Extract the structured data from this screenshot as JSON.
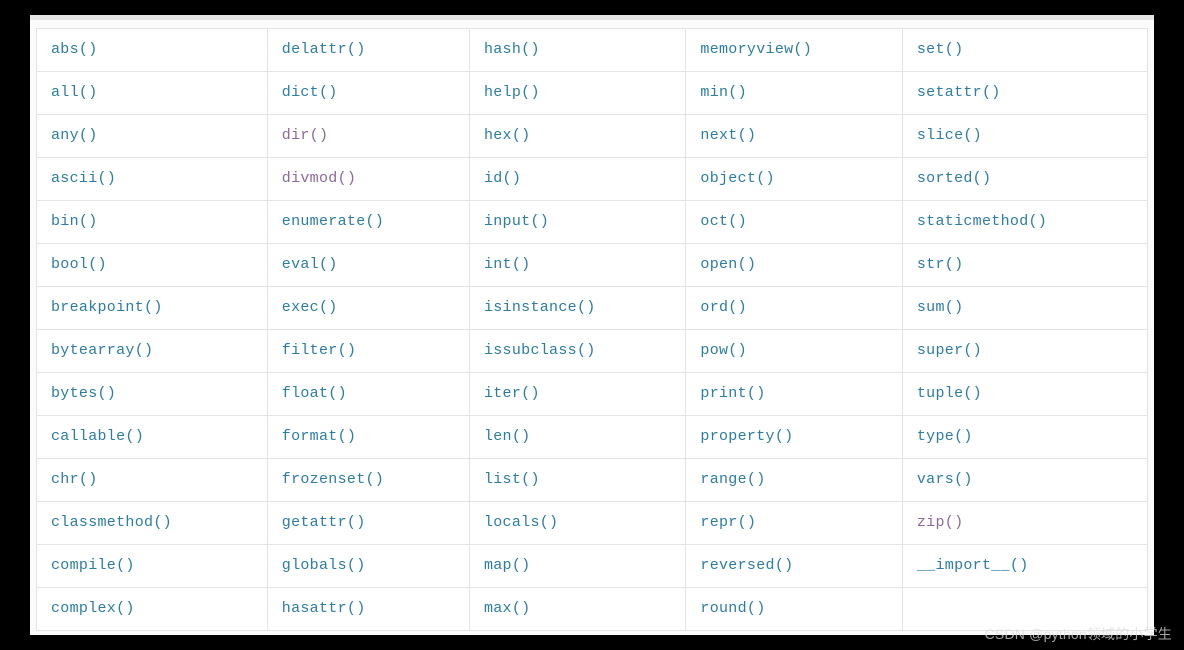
{
  "watermark": "CSDN @python领域的小学生",
  "table": {
    "columns": 5,
    "rows": [
      [
        {
          "label": "abs()"
        },
        {
          "label": "delattr()"
        },
        {
          "label": "hash()"
        },
        {
          "label": "memoryview()"
        },
        {
          "label": "set()"
        }
      ],
      [
        {
          "label": "all()"
        },
        {
          "label": "dict()"
        },
        {
          "label": "help()"
        },
        {
          "label": "min()"
        },
        {
          "label": "setattr()"
        }
      ],
      [
        {
          "label": "any()"
        },
        {
          "label": "dir()",
          "alt": true
        },
        {
          "label": "hex()"
        },
        {
          "label": "next()"
        },
        {
          "label": "slice()"
        }
      ],
      [
        {
          "label": "ascii()"
        },
        {
          "label": "divmod()",
          "alt": true
        },
        {
          "label": "id()"
        },
        {
          "label": "object()"
        },
        {
          "label": "sorted()"
        }
      ],
      [
        {
          "label": "bin()"
        },
        {
          "label": "enumerate()"
        },
        {
          "label": "input()"
        },
        {
          "label": "oct()"
        },
        {
          "label": "staticmethod()"
        }
      ],
      [
        {
          "label": "bool()"
        },
        {
          "label": "eval()"
        },
        {
          "label": "int()"
        },
        {
          "label": "open()"
        },
        {
          "label": "str()"
        }
      ],
      [
        {
          "label": "breakpoint()"
        },
        {
          "label": "exec()"
        },
        {
          "label": "isinstance()"
        },
        {
          "label": "ord()"
        },
        {
          "label": "sum()"
        }
      ],
      [
        {
          "label": "bytearray()"
        },
        {
          "label": "filter()"
        },
        {
          "label": "issubclass()"
        },
        {
          "label": "pow()"
        },
        {
          "label": "super()"
        }
      ],
      [
        {
          "label": "bytes()"
        },
        {
          "label": "float()"
        },
        {
          "label": "iter()"
        },
        {
          "label": "print()"
        },
        {
          "label": "tuple()"
        }
      ],
      [
        {
          "label": "callable()"
        },
        {
          "label": "format()"
        },
        {
          "label": "len()"
        },
        {
          "label": "property()"
        },
        {
          "label": "type()"
        }
      ],
      [
        {
          "label": "chr()"
        },
        {
          "label": "frozenset()"
        },
        {
          "label": "list()"
        },
        {
          "label": "range()"
        },
        {
          "label": "vars()"
        }
      ],
      [
        {
          "label": "classmethod()"
        },
        {
          "label": "getattr()"
        },
        {
          "label": "locals()"
        },
        {
          "label": "repr()"
        },
        {
          "label": "zip()",
          "alt": true
        }
      ],
      [
        {
          "label": "compile()"
        },
        {
          "label": "globals()"
        },
        {
          "label": "map()"
        },
        {
          "label": "reversed()"
        },
        {
          "label": "__import__()"
        }
      ],
      [
        {
          "label": "complex()"
        },
        {
          "label": "hasattr()"
        },
        {
          "label": "max()"
        },
        {
          "label": "round()"
        },
        {
          "label": ""
        }
      ]
    ]
  }
}
